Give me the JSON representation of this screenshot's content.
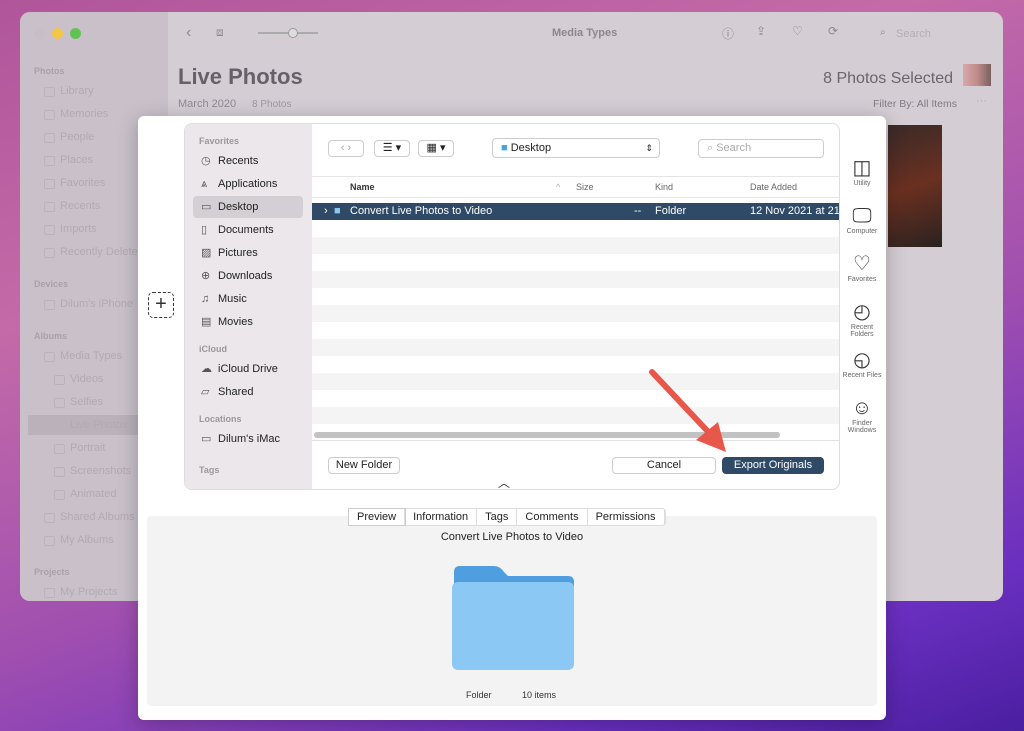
{
  "photos": {
    "toolbar": {
      "title": "Media Types",
      "search_placeholder": "Search"
    },
    "header": {
      "title": "Live Photos",
      "date": "March 2020",
      "count": "8 Photos",
      "selected": "8 Photos Selected",
      "filter": "Filter By: All Items"
    },
    "sidebar": {
      "sections": [
        {
          "title": "Photos",
          "items": [
            "Library",
            "Memories",
            "People",
            "Places",
            "Favorites",
            "Recents",
            "Imports",
            "Recently Deleted"
          ]
        },
        {
          "title": "Devices",
          "items": [
            "Dilum's iPhone"
          ]
        },
        {
          "title": "Albums",
          "items": [
            "Media Types",
            "Videos",
            "Selfies",
            "Live Photos",
            "Portrait",
            "Screenshots",
            "Animated",
            "Shared Albums",
            "My Albums"
          ]
        },
        {
          "title": "Projects",
          "items": [
            "My Projects"
          ]
        }
      ],
      "selected": "Live Photos"
    }
  },
  "dialog": {
    "sidebar": {
      "favorites_title": "Favorites",
      "favorites": [
        {
          "label": "Recents",
          "icon": "clock-icon"
        },
        {
          "label": "Applications",
          "icon": "applications-icon"
        },
        {
          "label": "Desktop",
          "icon": "desktop-icon"
        },
        {
          "label": "Documents",
          "icon": "document-icon"
        },
        {
          "label": "Pictures",
          "icon": "pictures-icon"
        },
        {
          "label": "Downloads",
          "icon": "download-icon"
        },
        {
          "label": "Music",
          "icon": "music-icon"
        },
        {
          "label": "Movies",
          "icon": "film-icon"
        }
      ],
      "icloud_title": "iCloud",
      "icloud": [
        {
          "label": "iCloud Drive",
          "icon": "cloud-icon"
        },
        {
          "label": "Shared",
          "icon": "shared-folder-icon"
        }
      ],
      "locations_title": "Locations",
      "locations": [
        {
          "label": "Dilum's iMac",
          "icon": "computer-icon"
        }
      ],
      "tags_title": "Tags",
      "selected": "Desktop"
    },
    "location": "Desktop",
    "search_placeholder": "Search",
    "columns": [
      "Name",
      "Size",
      "Kind",
      "Date Added"
    ],
    "rows": [
      {
        "name": "Convert Live Photos to Video",
        "size": "--",
        "kind": "Folder",
        "date": "12 Nov 2021 at 21:",
        "selected": true
      }
    ],
    "new_folder": "New Folder",
    "cancel": "Cancel",
    "export": "Export Originals",
    "right_icons": [
      {
        "label": "Utility",
        "icon": "utility-folder-icon"
      },
      {
        "label": "Computer",
        "icon": "computer-icon"
      },
      {
        "label": "Favorites",
        "icon": "heart-icon"
      },
      {
        "label": "Recent Folders",
        "icon": "recent-folders-icon"
      },
      {
        "label": "Recent Files",
        "icon": "recent-files-icon"
      },
      {
        "label": "Finder Windows",
        "icon": "finder-icon"
      }
    ],
    "tabs": [
      "Preview",
      "Information",
      "Tags",
      "Comments",
      "Permissions"
    ],
    "active_tab": "Preview",
    "preview": {
      "name": "Convert Live Photos to Video",
      "kind": "Folder",
      "items": "10 items"
    },
    "accent": "#2f4a66",
    "annotation_arrow_color": "#e8584a"
  }
}
